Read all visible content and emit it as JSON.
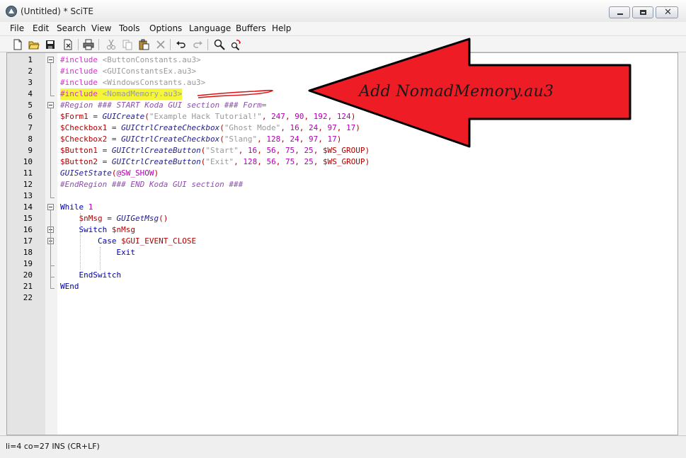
{
  "window": {
    "title": "(Untitled) * SciTE"
  },
  "menu": [
    "File",
    "Edit",
    "Search",
    "View",
    "Tools",
    "Options",
    "Language",
    "Buffers",
    "Help"
  ],
  "toolbar": [
    "new-file-icon",
    "open-folder-icon",
    "save-icon",
    "close-file-icon",
    "print-icon",
    "cut-icon",
    "copy-icon",
    "paste-icon",
    "delete-icon",
    "undo-icon",
    "redo-icon",
    "find-icon",
    "replace-icon"
  ],
  "editor": {
    "lines": [
      [
        {
          "t": "#include ",
          "c": "pp"
        },
        {
          "t": "<ButtonConstants.au3>",
          "c": "str"
        }
      ],
      [
        {
          "t": "#include ",
          "c": "pp"
        },
        {
          "t": "<GUIConstantsEx.au3>",
          "c": "str"
        }
      ],
      [
        {
          "t": "#include ",
          "c": "pp"
        },
        {
          "t": "<WindowsConstants.au3>",
          "c": "str"
        }
      ],
      [
        {
          "t": "#include ",
          "c": "pp"
        },
        {
          "t": "<NomadMemory.au3>",
          "c": "str"
        }
      ],
      [
        {
          "t": "#Region ### START Koda GUI section ### Form=",
          "c": "cmt"
        }
      ],
      [
        {
          "t": "$Form1",
          "c": "var"
        },
        {
          "t": " = ",
          "c": "op"
        },
        {
          "t": "GUICreate",
          "c": "fn"
        },
        {
          "t": "(",
          "c": "op"
        },
        {
          "t": "\"Example Hack Tutorial!\"",
          "c": "str"
        },
        {
          "t": ", ",
          "c": "op"
        },
        {
          "t": "247",
          "c": "num"
        },
        {
          "t": ", ",
          "c": "op"
        },
        {
          "t": "90",
          "c": "num"
        },
        {
          "t": ", ",
          "c": "op"
        },
        {
          "t": "192",
          "c": "num"
        },
        {
          "t": ", ",
          "c": "op"
        },
        {
          "t": "124",
          "c": "num"
        },
        {
          "t": ")",
          "c": "op"
        }
      ],
      [
        {
          "t": "$Checkbox1",
          "c": "var"
        },
        {
          "t": " = ",
          "c": "op"
        },
        {
          "t": "GUICtrlCreateCheckbox",
          "c": "fn"
        },
        {
          "t": "(",
          "c": "op"
        },
        {
          "t": "\"Ghost Mode\"",
          "c": "str"
        },
        {
          "t": ", ",
          "c": "op"
        },
        {
          "t": "16",
          "c": "num"
        },
        {
          "t": ", ",
          "c": "op"
        },
        {
          "t": "24",
          "c": "num"
        },
        {
          "t": ", ",
          "c": "op"
        },
        {
          "t": "97",
          "c": "num"
        },
        {
          "t": ", ",
          "c": "op"
        },
        {
          "t": "17",
          "c": "num"
        },
        {
          "t": ")",
          "c": "op"
        }
      ],
      [
        {
          "t": "$Checkbox2",
          "c": "var"
        },
        {
          "t": " = ",
          "c": "op"
        },
        {
          "t": "GUICtrlCreateCheckbox",
          "c": "fn"
        },
        {
          "t": "(",
          "c": "op"
        },
        {
          "t": "\"Slang\"",
          "c": "str"
        },
        {
          "t": ", ",
          "c": "op"
        },
        {
          "t": "128",
          "c": "num"
        },
        {
          "t": ", ",
          "c": "op"
        },
        {
          "t": "24",
          "c": "num"
        },
        {
          "t": ", ",
          "c": "op"
        },
        {
          "t": "97",
          "c": "num"
        },
        {
          "t": ", ",
          "c": "op"
        },
        {
          "t": "17",
          "c": "num"
        },
        {
          "t": ")",
          "c": "op"
        }
      ],
      [
        {
          "t": "$Button1",
          "c": "var"
        },
        {
          "t": " = ",
          "c": "op"
        },
        {
          "t": "GUICtrlCreateButton",
          "c": "fn"
        },
        {
          "t": "(",
          "c": "op"
        },
        {
          "t": "\"Start\"",
          "c": "str"
        },
        {
          "t": ", ",
          "c": "op"
        },
        {
          "t": "16",
          "c": "num"
        },
        {
          "t": ", ",
          "c": "op"
        },
        {
          "t": "56",
          "c": "num"
        },
        {
          "t": ", ",
          "c": "op"
        },
        {
          "t": "75",
          "c": "num"
        },
        {
          "t": ", ",
          "c": "op"
        },
        {
          "t": "25",
          "c": "num"
        },
        {
          "t": ", ",
          "c": "op"
        },
        {
          "t": "$WS_GROUP",
          "c": "var"
        },
        {
          "t": ")",
          "c": "op"
        }
      ],
      [
        {
          "t": "$Button2",
          "c": "var"
        },
        {
          "t": " = ",
          "c": "op"
        },
        {
          "t": "GUICtrlCreateButton",
          "c": "fn"
        },
        {
          "t": "(",
          "c": "op"
        },
        {
          "t": "\"Exit\"",
          "c": "str"
        },
        {
          "t": ", ",
          "c": "op"
        },
        {
          "t": "128",
          "c": "num"
        },
        {
          "t": ", ",
          "c": "op"
        },
        {
          "t": "56",
          "c": "num"
        },
        {
          "t": ", ",
          "c": "op"
        },
        {
          "t": "75",
          "c": "num"
        },
        {
          "t": ", ",
          "c": "op"
        },
        {
          "t": "25",
          "c": "num"
        },
        {
          "t": ", ",
          "c": "op"
        },
        {
          "t": "$WS_GROUP",
          "c": "var"
        },
        {
          "t": ")",
          "c": "op"
        }
      ],
      [
        {
          "t": "GUISetState",
          "c": "fn"
        },
        {
          "t": "(",
          "c": "op"
        },
        {
          "t": "@SW_SHOW",
          "c": "mac"
        },
        {
          "t": ")",
          "c": "op"
        }
      ],
      [
        {
          "t": "#EndRegion ### END Koda GUI section ###",
          "c": "cmt"
        }
      ],
      [],
      [
        {
          "t": "While ",
          "c": "kw"
        },
        {
          "t": "1",
          "c": "num"
        }
      ],
      [
        {
          "t": "    "
        },
        {
          "t": "$nMsg",
          "c": "var"
        },
        {
          "t": " = ",
          "c": "op"
        },
        {
          "t": "GUIGetMsg",
          "c": "fn"
        },
        {
          "t": "()",
          "c": "op"
        }
      ],
      [
        {
          "t": "    "
        },
        {
          "t": "Switch ",
          "c": "kw"
        },
        {
          "t": "$nMsg",
          "c": "var"
        }
      ],
      [
        {
          "t": "        "
        },
        {
          "t": "Case ",
          "c": "kw"
        },
        {
          "t": "$GUI_EVENT_CLOSE",
          "c": "var"
        }
      ],
      [
        {
          "t": "            "
        },
        {
          "t": "Exit",
          "c": "kw"
        }
      ],
      [],
      [
        {
          "t": "    "
        },
        {
          "t": "EndSwitch",
          "c": "kw"
        }
      ],
      [
        {
          "t": "WEnd",
          "c": "kw"
        }
      ],
      []
    ],
    "highlighted_line": 4,
    "fold_lines": [
      1,
      5,
      14,
      16,
      17
    ]
  },
  "annotation": {
    "text": "Add NomadMemory.au3",
    "arrow_color": "#ee1c24",
    "scribble_color": "#e01010"
  },
  "status": {
    "text": "li=4 co=27 INS (CR+LF)"
  }
}
